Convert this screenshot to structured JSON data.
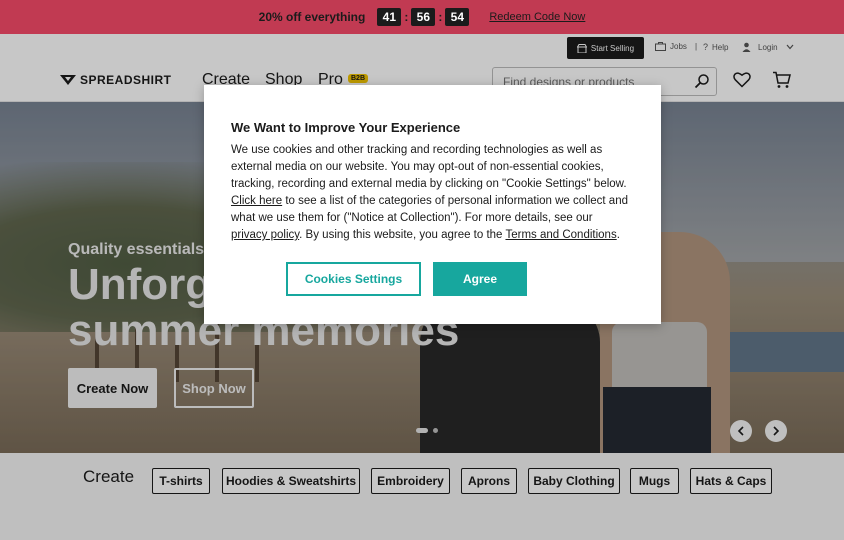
{
  "promo": {
    "text": "20% off everything",
    "timer": [
      "41",
      "56",
      "54"
    ],
    "separator": ":",
    "link": "Redeem Code Now"
  },
  "topbar": {
    "start_selling": "Start Selling",
    "jobs": "Jobs",
    "help": "Help",
    "login": "Login",
    "divider": "|"
  },
  "header": {
    "logo": "SPREADSHIRT",
    "nav": [
      "Create",
      "Shop",
      "Pro"
    ],
    "pro_badge": "B2B",
    "search_placeholder": "Find designs or products"
  },
  "hero": {
    "eyebrow": "Quality essentials",
    "title_line1": "Unforg",
    "title_line2": "summer memories",
    "create_now": "Create Now",
    "shop_now": "Shop Now"
  },
  "create": {
    "label": "Create",
    "chips": [
      "T-shirts",
      "Hoodies & Sweatshirts",
      "Embroidery",
      "Aprons",
      "Baby Clothing",
      "Mugs",
      "Hats & Caps"
    ]
  },
  "modal": {
    "title": "We Want to Improve Your Experience",
    "body_part1": "We use cookies and other tracking and recording technologies as well as external media on our website. You may opt-out of non-essential cookies, tracking, recording and external media by clicking on \"Cookie Settings\" below.",
    "click_here": "Click here",
    "body_part2": "to see a list of the categories of personal information we collect and what we use them for (\"Notice at Collection\"). For more details, see our",
    "privacy_policy": "privacy policy",
    "body_part3": ". By using this website, you agree to the",
    "terms": "Terms and Conditions",
    "body_end": ".",
    "cookies_settings": "Cookies Settings",
    "agree": "Agree"
  },
  "colors": {
    "promo_bg": "#c13a52",
    "accent_teal": "#17a79e",
    "pro_badge": "#f2c400"
  }
}
